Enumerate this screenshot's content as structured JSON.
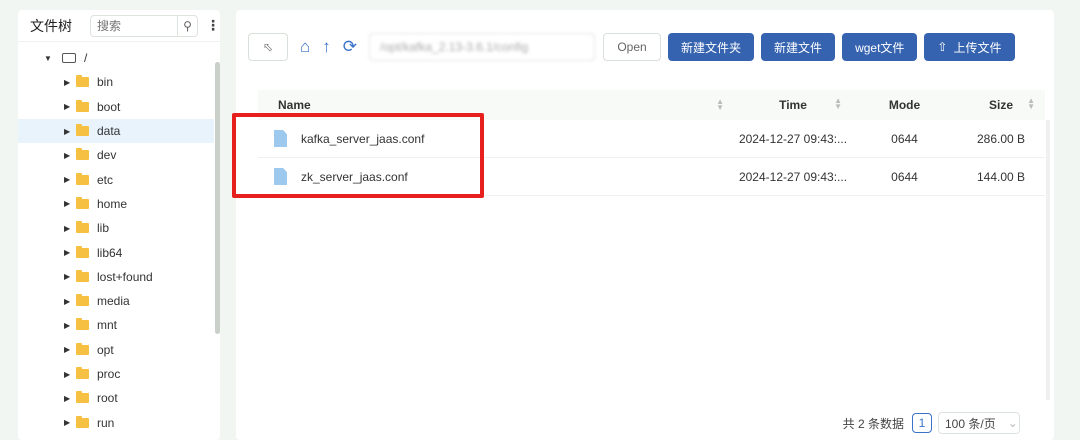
{
  "sidebar": {
    "title": "文件树",
    "search_placeholder": "搜索",
    "root": "/",
    "items": [
      "bin",
      "boot",
      "data",
      "dev",
      "etc",
      "home",
      "lib",
      "lib64",
      "lost+found",
      "media",
      "mnt",
      "opt",
      "proc",
      "root",
      "run"
    ],
    "selected": "data"
  },
  "toolbar": {
    "path": "/opt/kafka_2.13-3.6.1/config",
    "open": "Open",
    "new_folder": "新建文件夹",
    "new_file": "新建文件",
    "wget": "wget文件",
    "upload": "上传文件"
  },
  "table": {
    "headers": [
      "Name",
      "Time",
      "Mode",
      "Size"
    ],
    "rows": [
      {
        "name": "kafka_server_jaas.conf",
        "time": "2024-12-27 09:43:...",
        "mode": "0644",
        "size": "286.00 B"
      },
      {
        "name": "zk_server_jaas.conf",
        "time": "2024-12-27 09:43:...",
        "mode": "0644",
        "size": "144.00 B"
      }
    ]
  },
  "pager": {
    "total": "共 2 条数据",
    "page": "1",
    "page_size": "100 条/页"
  },
  "colors": {
    "primary": "#3563b0",
    "highlight": "#e8201d"
  }
}
